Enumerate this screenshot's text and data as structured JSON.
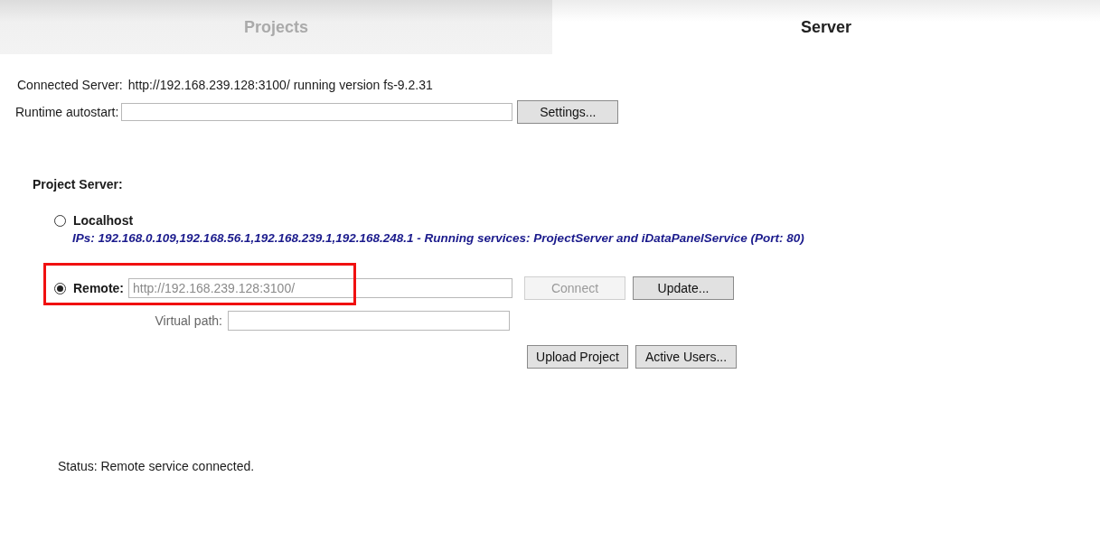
{
  "tabs": [
    {
      "label": "Projects",
      "selected": false
    },
    {
      "label": "Server",
      "selected": true
    }
  ],
  "connected_server": {
    "label": "Connected Server:",
    "value": "http://192.168.239.128:3100/ running version fs-9.2.31"
  },
  "runtime_autostart": {
    "label": "Runtime autostart:",
    "button": "Settings..."
  },
  "project_server": {
    "title": "Project Server:",
    "localhost": {
      "label": "Localhost",
      "selected": false,
      "info": "IPs: 192.168.0.109,192.168.56.1,192.168.239.1,192.168.248.1 - Running services: ProjectServer and iDataPanelService (Port: 80)"
    },
    "remote": {
      "label": "Remote:",
      "selected": true,
      "value": "http://192.168.239.128:3100/",
      "connect": {
        "label": "Connect",
        "disabled": true
      },
      "update": "Update..."
    },
    "virtual_path": {
      "label": "Virtual path:"
    },
    "buttons": [
      "Upload Project",
      "Active Users..."
    ]
  },
  "status": "Status: Remote service connected."
}
